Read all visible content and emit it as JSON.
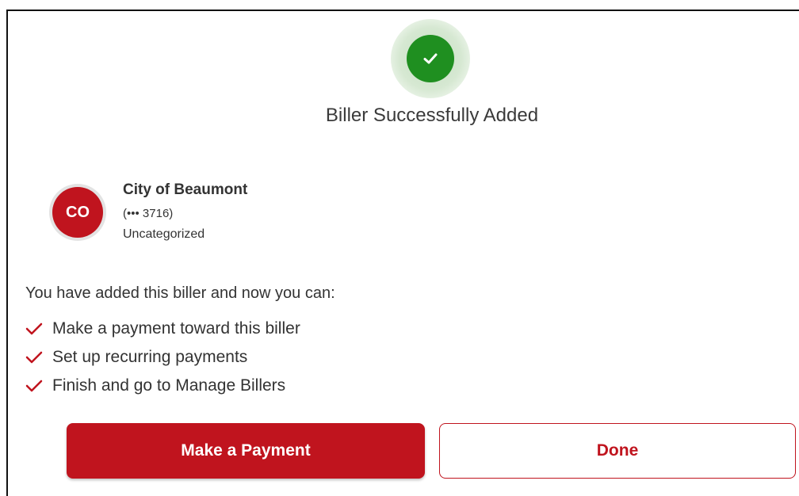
{
  "dialog": {
    "title": "Biller Successfully Added",
    "status_icon": "check-icon",
    "colors": {
      "success": "#1f8f20",
      "accent": "#c0141e"
    }
  },
  "biller": {
    "initials": "CO",
    "name": "City of Beaumont",
    "account": "(••• 3716)",
    "category": "Uncategorized"
  },
  "capabilities": {
    "intro": "You have added this biller and now you can:",
    "items": [
      "Make a payment toward this biller",
      "Set up recurring payments",
      "Finish and go to Manage Billers"
    ]
  },
  "actions": {
    "primary_label": "Make a Payment",
    "secondary_label": "Done"
  }
}
